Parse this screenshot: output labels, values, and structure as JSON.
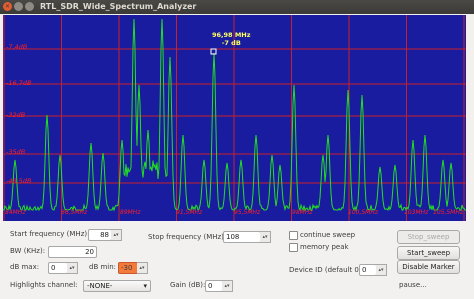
{
  "window": {
    "title": "RTL_SDR_Wide_Spectrum_Analyzer"
  },
  "plot": {
    "y_labels": [
      "-7,4dB",
      "-16,7dB",
      "-32dB",
      "-35dB",
      "-48,5dB"
    ],
    "x_labels": [
      "84MHz",
      "86,5MHz",
      "89MHz",
      "91,5MHz",
      "95,5MHz",
      "98MHz",
      "100,5MHz",
      "103MHz",
      "105,5MHz"
    ],
    "marker": {
      "freq": "96,98 MHz",
      "level": "-7 dB"
    }
  },
  "controls": {
    "start_freq": {
      "label": "Start frequency (MHz):",
      "value": "88"
    },
    "stop_freq": {
      "label": "Stop frequency (MHz) :",
      "value": "108"
    },
    "bw": {
      "label": "BW (KHz):",
      "value": "20"
    },
    "db_max": {
      "label": "dB max:",
      "value": "0"
    },
    "db_min": {
      "label": "dB min:",
      "value": "-30"
    },
    "highlights": {
      "label": "Highlights channel:",
      "value": "-NONE-"
    },
    "gain": {
      "label": "Gain (dB):",
      "value": "0"
    },
    "continue_sweep": "continue sweep",
    "memory_peak": "memory peak",
    "device_id": {
      "label": "Device ID (default 0) :",
      "value": "0"
    },
    "stop_sweep": "Stop_sweep",
    "start_sweep": "Start_sweep",
    "disable_marker": "Disable Marker",
    "status": "pause..."
  },
  "colors": {
    "plot_bg": "#1a1ca0",
    "trace": "#22e022",
    "grid": "#c8202a",
    "accent": "#f47a3c"
  }
}
